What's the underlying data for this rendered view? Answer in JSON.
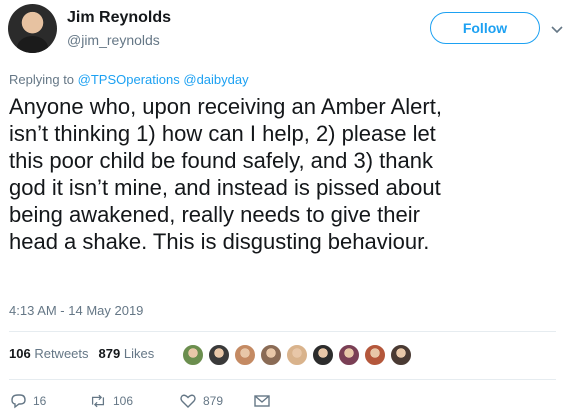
{
  "author": {
    "name": "Jim Reynolds",
    "handle": "@jim_reynolds"
  },
  "follow_button": {
    "label": "Follow"
  },
  "replying": {
    "prefix": "Replying to",
    "mentions": [
      "@TPSOperations",
      "@daibyday"
    ]
  },
  "tweet": {
    "text": "Anyone who, upon receiving an Amber Alert,\nisn’t thinking 1) how can I help, 2) please let\nthis poor child be found safely, and 3) thank\ngod it isn’t mine, and instead is pissed about\nbeing awakened, really needs to give their\nhead a shake. This is disgusting behaviour."
  },
  "timestamp": "4:13 AM - 14 May 2019",
  "stats": {
    "retweets_count": "106",
    "retweets_label": "Retweets",
    "likes_count": "879",
    "likes_label": "Likes"
  },
  "likers": [
    {
      "color": "#6b8e4e"
    },
    {
      "color": "#3a3a3a"
    },
    {
      "color": "#c48a63"
    },
    {
      "color": "#8a6b55"
    },
    {
      "color": "#d9b38c"
    },
    {
      "color": "#2c2c2c"
    },
    {
      "color": "#7a3f55"
    },
    {
      "color": "#b4573b"
    },
    {
      "color": "#4a3a33"
    }
  ],
  "actions": {
    "reply_count": "16",
    "retweet_count": "106",
    "like_count": "879"
  },
  "colors": {
    "accent": "#1da1f2",
    "muted": "#657786",
    "text": "#14171a"
  }
}
